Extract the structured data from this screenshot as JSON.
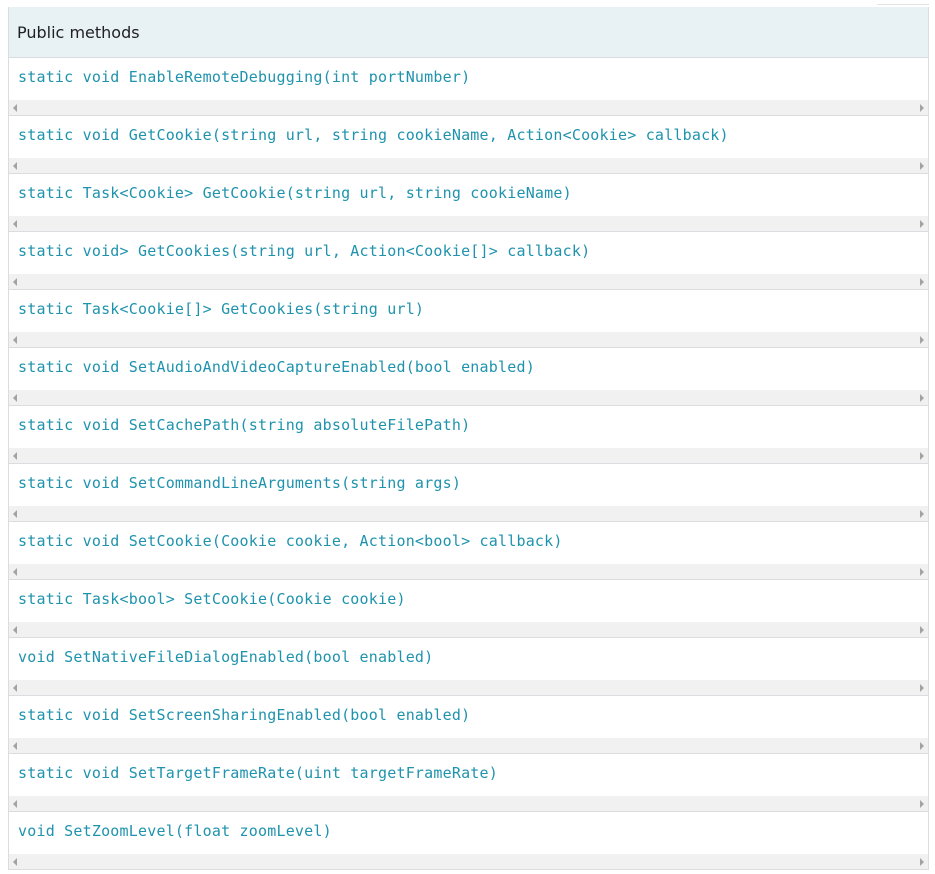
{
  "section": {
    "title": "Public methods"
  },
  "methods": [
    {
      "signature": "static void EnableRemoteDebugging(int portNumber)"
    },
    {
      "signature": "static void GetCookie(string url, string cookieName, Action<Cookie> callback)"
    },
    {
      "signature": "static Task<Cookie> GetCookie(string url, string cookieName)"
    },
    {
      "signature": "static void> GetCookies(string url, Action<Cookie[]> callback)"
    },
    {
      "signature": "static Task<Cookie[]> GetCookies(string url)"
    },
    {
      "signature": "static void SetAudioAndVideoCaptureEnabled(bool enabled)"
    },
    {
      "signature": "static void SetCachePath(string absoluteFilePath)"
    },
    {
      "signature": "static void SetCommandLineArguments(string args)"
    },
    {
      "signature": "static void SetCookie(Cookie cookie, Action<bool> callback)"
    },
    {
      "signature": "static Task<bool> SetCookie(Cookie cookie)"
    },
    {
      "signature": "void SetNativeFileDialogEnabled(bool enabled)"
    },
    {
      "signature": "static void SetScreenSharingEnabled(bool enabled)"
    },
    {
      "signature": "static void SetTargetFrameRate(uint targetFrameRate)"
    },
    {
      "signature": "void SetZoomLevel(float zoomLevel)"
    }
  ],
  "colors": {
    "header_background": "#e8f1f4",
    "signature_text": "#1f93ad",
    "border": "#dadce0",
    "scrollbar_track": "#f1f1f1"
  },
  "icons": {
    "scroll_left": "scroll-left-arrow-icon",
    "scroll_right": "scroll-right-arrow-icon"
  }
}
